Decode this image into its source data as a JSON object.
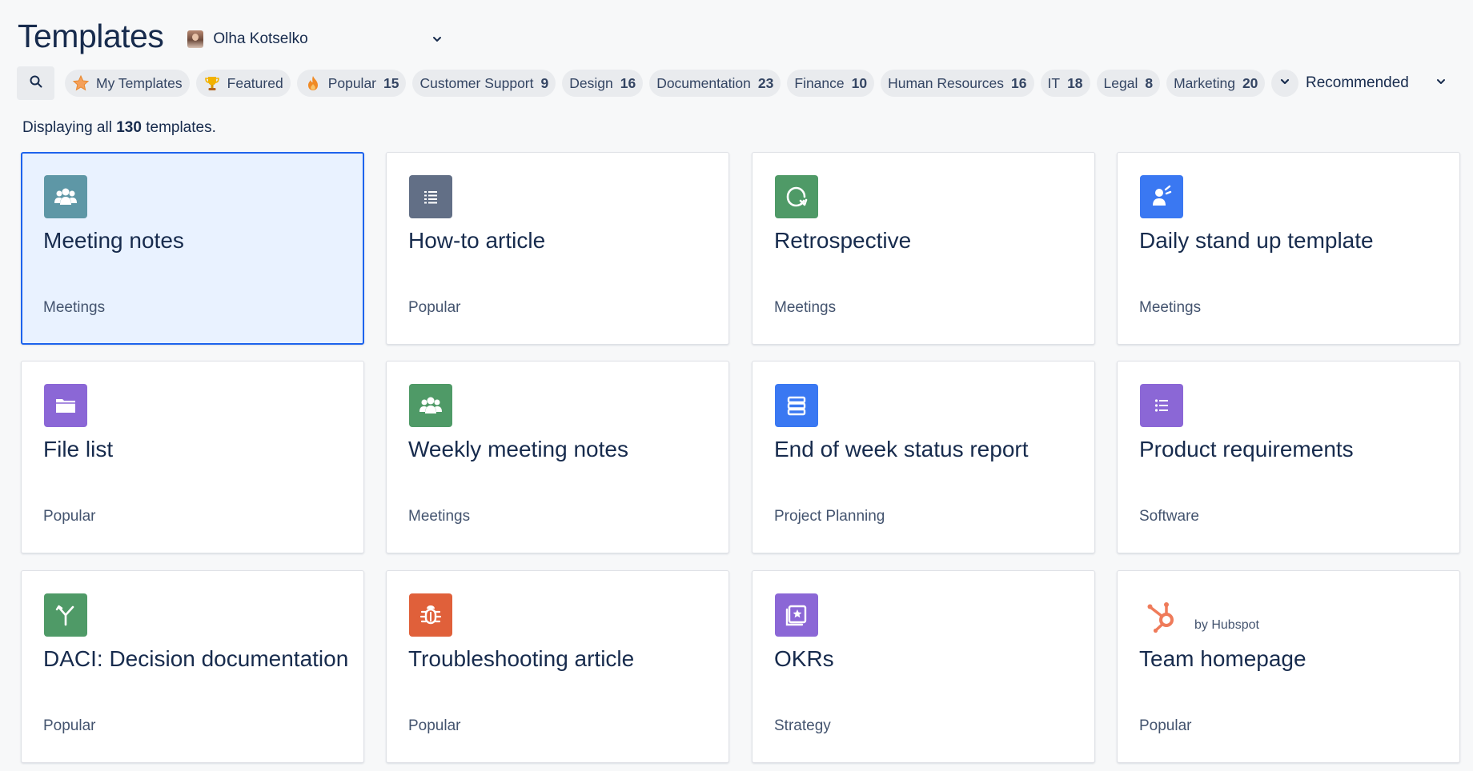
{
  "header": {
    "title": "Templates",
    "user_name": "Olha Kotselko"
  },
  "search": {
    "icon": "search-icon"
  },
  "chips": [
    {
      "label": "My Templates",
      "count": "",
      "icon": "star-icon",
      "icon_color": "#f5a623"
    },
    {
      "label": "Featured",
      "count": "",
      "icon": "trophy-icon",
      "icon_color": "#f2b200"
    },
    {
      "label": "Popular",
      "count": "15",
      "icon": "flame-icon",
      "icon_color": "#f08a24"
    },
    {
      "label": "Customer Support",
      "count": "9"
    },
    {
      "label": "Design",
      "count": "16"
    },
    {
      "label": "Documentation",
      "count": "23"
    },
    {
      "label": "Finance",
      "count": "10"
    },
    {
      "label": "Human Resources",
      "count": "16"
    },
    {
      "label": "IT",
      "count": "18"
    },
    {
      "label": "Legal",
      "count": "8"
    },
    {
      "label": "Marketing",
      "count": "20"
    }
  ],
  "sort": {
    "label": "Recommended"
  },
  "display": {
    "prefix": "Displaying all",
    "count": "130",
    "suffix": "templates."
  },
  "cards": [
    {
      "title": "Meeting notes",
      "category": "Meetings",
      "icon": "people-icon",
      "color": "#5e97a6",
      "selected": true
    },
    {
      "title": "How-to article",
      "category": "Popular",
      "icon": "list-icon",
      "color": "#626f86"
    },
    {
      "title": "Retrospective",
      "category": "Meetings",
      "icon": "retro-icon",
      "color": "#4f9a67"
    },
    {
      "title": "Daily stand up template",
      "category": "Meetings",
      "icon": "standup-icon",
      "color": "#3a78f2"
    },
    {
      "title": "File list",
      "category": "Popular",
      "icon": "folder-icon",
      "color": "#8b67d6"
    },
    {
      "title": "Weekly meeting notes",
      "category": "Meetings",
      "icon": "people-icon",
      "color": "#4f9a67"
    },
    {
      "title": "End of week status report",
      "category": "Project Planning",
      "icon": "report-icon",
      "color": "#3a78f2"
    },
    {
      "title": "Product requirements",
      "category": "Software",
      "icon": "bullets-icon",
      "color": "#8b67d6"
    },
    {
      "title": "DACI: Decision documentation",
      "category": "Popular",
      "icon": "decision-icon",
      "color": "#4f9a67"
    },
    {
      "title": "Troubleshooting article",
      "category": "Popular",
      "icon": "bug-icon",
      "color": "#e0603a"
    },
    {
      "title": "OKRs",
      "category": "Strategy",
      "icon": "star-frame-icon",
      "color": "#8b67d6"
    },
    {
      "title": "Team homepage",
      "category": "Popular",
      "icon": "hubspot-icon",
      "color": "#ef7b5a",
      "byline": "by Hubspot"
    }
  ]
}
